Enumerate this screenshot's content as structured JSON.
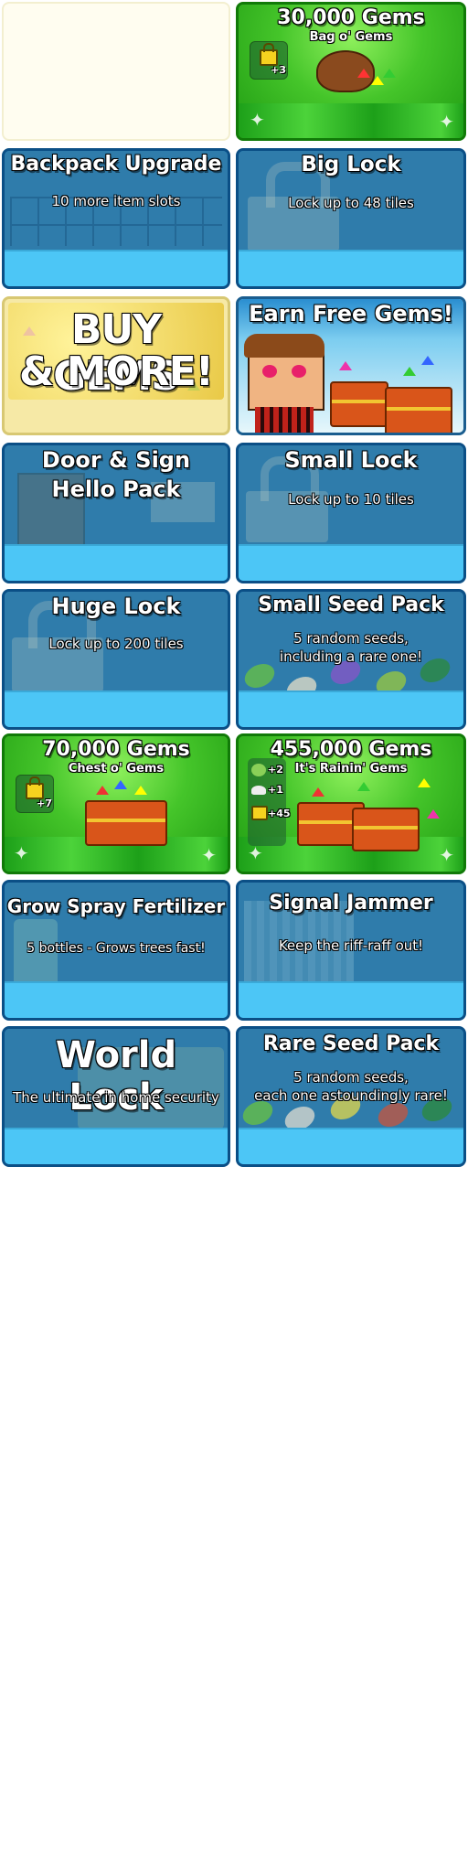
{
  "cards": {
    "gems30k": {
      "title": "30,000 Gems",
      "sub": "Bag o' Gems",
      "badge": "+3"
    },
    "backpack": {
      "title": "Backpack Upgrade",
      "desc": "10 more item slots"
    },
    "biglock": {
      "title": "Big Lock",
      "desc": "Lock up to 48 tiles"
    },
    "buygems": {
      "line1": "BUY GEMS",
      "line2": "& MORE!"
    },
    "earnfree": {
      "title": "Earn Free Gems!"
    },
    "doorsign": {
      "line1": "Door & Sign",
      "line2": "Hello Pack"
    },
    "smalllock": {
      "title": "Small Lock",
      "desc": "Lock up to 10 tiles"
    },
    "hugelock": {
      "title": "Huge Lock",
      "desc": "Lock up to 200 tiles"
    },
    "smallseed": {
      "title": "Small Seed Pack",
      "desc1": "5 random seeds,",
      "desc2": "including a rare one!"
    },
    "gems70k": {
      "title": "70,000 Gems",
      "sub": "Chest o' Gems",
      "badge": "+7"
    },
    "gems455k": {
      "title": "455,000 Gems",
      "sub": "It's Rainin' Gems",
      "b1": "+2",
      "b2": "+1",
      "b3": "+45"
    },
    "growspray": {
      "title": "Grow Spray Fertilizer",
      "desc": "5 bottles - Grows trees fast!"
    },
    "jammer": {
      "title": "Signal Jammer",
      "desc": "Keep the riff-raff out!"
    },
    "worldlock": {
      "title": "World Lock",
      "desc": "The ultimate in home security"
    },
    "rareseed": {
      "title": "Rare Seed Pack",
      "desc1": "5 random seeds,",
      "desc2": "each one astoundingly rare!"
    }
  },
  "colors": {
    "card_blue": "#1e86c9",
    "card_green": "#3cba1e",
    "footer_blue": "#4cc6f6",
    "buy_gems_bg": "#f6e9a6"
  }
}
